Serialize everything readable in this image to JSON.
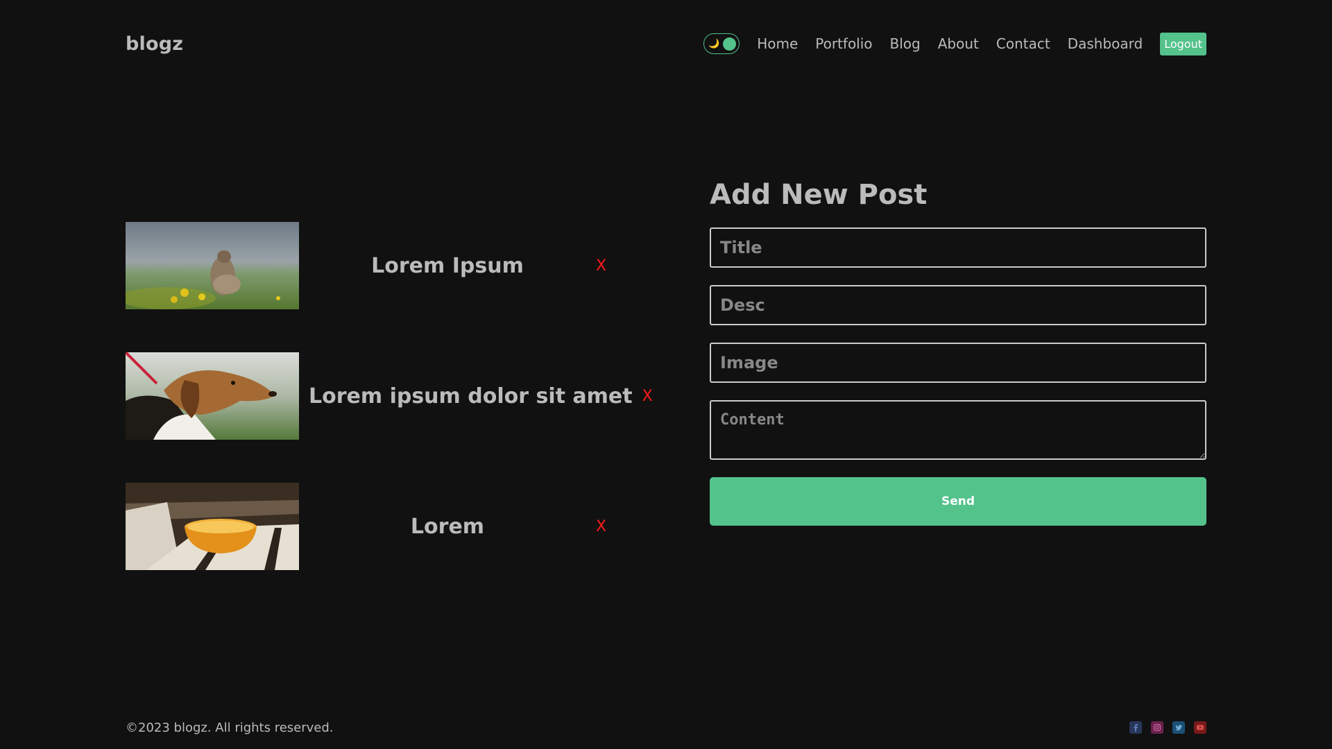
{
  "nav": {
    "logo": "blogz",
    "links": [
      "Home",
      "Portfolio",
      "Blog",
      "About",
      "Contact",
      "Dashboard"
    ],
    "logout_label": "Logout",
    "theme_toggle": {
      "icon": "moon-icon",
      "glyph": "🌙",
      "accent": "#53c28b"
    }
  },
  "posts": [
    {
      "title": "Lorem Ipsum",
      "image": "marmot-photo",
      "delete_label": "X"
    },
    {
      "title": "Lorem ipsum dolor sit amet",
      "image": "beagle-photo",
      "delete_label": "X"
    },
    {
      "title": "Lorem",
      "image": "orange-dessert-photo",
      "delete_label": "X"
    }
  ],
  "form": {
    "heading": "Add New Post",
    "title_placeholder": "Title",
    "desc_placeholder": "Desc",
    "image_placeholder": "Image",
    "content_placeholder": "Content",
    "send_label": "Send"
  },
  "footer": {
    "copyright": "©2023 blogz. All rights reserved.",
    "socials": [
      {
        "name": "facebook-icon",
        "color": "#3b5998"
      },
      {
        "name": "instagram-icon",
        "color": "#c13584"
      },
      {
        "name": "twitter-icon",
        "color": "#1da1f2"
      },
      {
        "name": "youtube-icon",
        "color": "#ff0000"
      }
    ]
  },
  "colors": {
    "background": "#111111",
    "text": "#bbbbbb",
    "accent": "#53c28b",
    "delete": "#ff1a1a"
  }
}
